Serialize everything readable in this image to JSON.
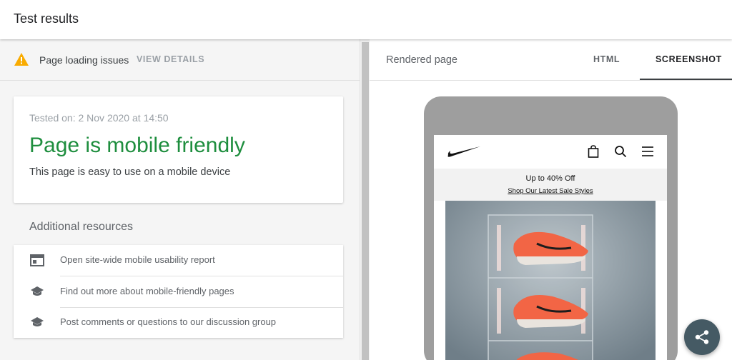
{
  "header": {
    "title": "Test results"
  },
  "issues": {
    "label": "Page loading issues",
    "action": "VIEW DETAILS",
    "icon": "warning-icon",
    "icon_color": "#f9ab00"
  },
  "result": {
    "tested_on": "Tested on: 2 Nov 2020 at 14:50",
    "headline": "Page is mobile friendly",
    "subline": "This page is easy to use on a mobile device",
    "headline_color": "#1e8e3e"
  },
  "resources": {
    "heading": "Additional resources",
    "items": [
      {
        "label": "Open site-wide mobile usability report",
        "icon": "report-icon"
      },
      {
        "label": "Find out more about mobile-friendly pages",
        "icon": "school-icon"
      },
      {
        "label": "Post comments or questions to our discussion group",
        "icon": "school-icon"
      }
    ]
  },
  "right": {
    "label": "Rendered page",
    "tabs": [
      {
        "label": "HTML",
        "active": false
      },
      {
        "label": "SCREENSHOT",
        "active": true
      }
    ]
  },
  "preview": {
    "promo_title": "Up to 40% Off",
    "promo_link": "Shop Our Latest Sale Styles",
    "icons": [
      "nike-logo",
      "bag-icon",
      "search-icon",
      "menu-icon"
    ]
  },
  "fab": {
    "icon": "share-icon",
    "color": "#455a64"
  }
}
